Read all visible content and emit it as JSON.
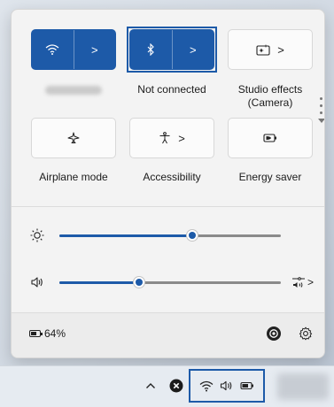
{
  "quick_settings": {
    "tiles": [
      {
        "id": "wifi",
        "icon": "wifi-icon",
        "label": "",
        "state": "on",
        "has_chevron": true,
        "chevron": ">"
      },
      {
        "id": "bluetooth",
        "icon": "bluetooth-icon",
        "label": "Not connected",
        "state": "on",
        "has_chevron": true,
        "chevron": ">",
        "focused": true
      },
      {
        "id": "studio-effects",
        "icon": "studio-effects-icon",
        "label": "Studio effects (Camera)",
        "state": "off",
        "has_chevron": true,
        "chevron": ">"
      },
      {
        "id": "airplane",
        "icon": "airplane-icon",
        "label": "Airplane mode",
        "state": "off",
        "has_chevron": false
      },
      {
        "id": "accessibility",
        "icon": "accessibility-icon",
        "label": "Accessibility",
        "state": "off",
        "has_chevron": true,
        "chevron": ">"
      },
      {
        "id": "energy-saver",
        "icon": "energy-saver-icon",
        "label": "Energy saver",
        "state": "off",
        "has_chevron": false
      }
    ],
    "brightness": {
      "icon": "brightness-icon",
      "value_percent": 60
    },
    "volume": {
      "icon": "speaker-icon",
      "value_percent": 36,
      "output_icon": "audio-output-icon",
      "chevron": ">"
    },
    "footer": {
      "battery_icon": "battery-icon",
      "battery_text": "64%",
      "buttons": [
        {
          "icon": "copilot-icon"
        },
        {
          "icon": "gear-icon"
        }
      ]
    }
  },
  "taskbar": {
    "chevron": "^",
    "tray_icons": [
      "chevron-up-icon",
      "close-circle-icon",
      "wifi-icon",
      "speaker-icon",
      "battery-icon"
    ]
  },
  "colors": {
    "accent": "#1d5aa8",
    "panel": "#f3f3f3",
    "tile_off": "#fbfbfb"
  }
}
